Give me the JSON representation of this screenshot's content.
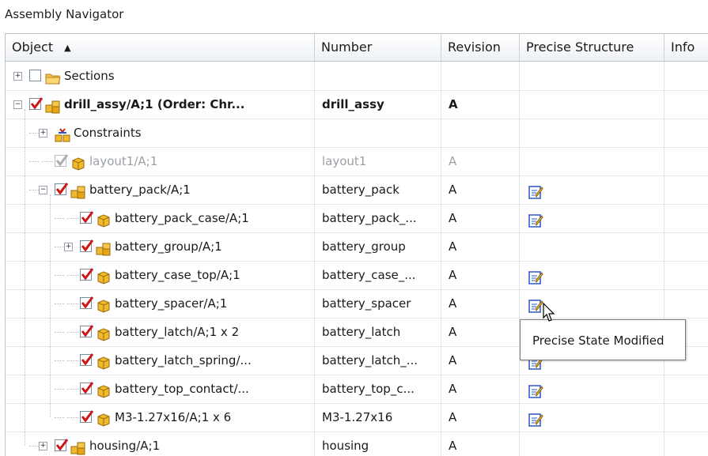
{
  "panel": {
    "title": "Assembly Navigator"
  },
  "columns": {
    "object": "Object",
    "number": "Number",
    "revision": "Revision",
    "precise_structure": "Precise Structure",
    "info": "Info"
  },
  "rows": [
    {
      "object": "Sections",
      "number": "",
      "revision": "",
      "level": 0,
      "expander": "+",
      "checked": "empty",
      "icon": "folder-icon",
      "precise_state_modified": false
    },
    {
      "object": "drill_assy/A;1 (Order: Chr...",
      "number": "drill_assy",
      "revision": "A",
      "level": 0,
      "expander": "-",
      "checked": "checked",
      "icon": "assembly-icon",
      "bold": true,
      "precise_state_modified": false
    },
    {
      "object": "Constraints",
      "number": "",
      "revision": "",
      "level": 1,
      "expander": "+",
      "checked": "none",
      "icon": "constraints-icon",
      "precise_state_modified": false
    },
    {
      "object": "layout1/A;1",
      "number": "layout1",
      "revision": "A",
      "level": 1,
      "expander": "",
      "checked": "greyed",
      "icon": "part-icon",
      "grey": true,
      "precise_state_modified": false
    },
    {
      "object": "battery_pack/A;1",
      "number": "battery_pack",
      "revision": "A",
      "level": 1,
      "expander": "-",
      "checked": "checked",
      "icon": "assembly-icon",
      "precise_state_modified": true
    },
    {
      "object": "battery_pack_case/A;1",
      "number": "battery_pack_...",
      "revision": "A",
      "level": 2,
      "expander": "",
      "checked": "checked",
      "icon": "part-icon",
      "precise_state_modified": true
    },
    {
      "object": "battery_group/A;1",
      "number": "battery_group",
      "revision": "A",
      "level": 2,
      "expander": "+",
      "checked": "checked",
      "icon": "assembly-icon",
      "precise_state_modified": false
    },
    {
      "object": "battery_case_top/A;1",
      "number": "battery_case_...",
      "revision": "A",
      "level": 2,
      "expander": "",
      "checked": "checked",
      "icon": "part-icon",
      "precise_state_modified": true
    },
    {
      "object": "battery_spacer/A;1",
      "number": "battery_spacer",
      "revision": "A",
      "level": 2,
      "expander": "",
      "checked": "checked",
      "icon": "part-icon",
      "precise_state_modified": true
    },
    {
      "object": "battery_latch/A;1 x 2",
      "number": "battery_latch",
      "revision": "A",
      "level": 2,
      "expander": "",
      "checked": "checked",
      "icon": "part-icon",
      "precise_state_modified": false
    },
    {
      "object": "battery_latch_spring/...",
      "number": "battery_latch_...",
      "revision": "A",
      "level": 2,
      "expander": "",
      "checked": "checked",
      "icon": "part-icon",
      "precise_state_modified": true
    },
    {
      "object": "battery_top_contact/...",
      "number": "battery_top_c...",
      "revision": "A",
      "level": 2,
      "expander": "",
      "checked": "checked",
      "icon": "part-icon",
      "precise_state_modified": true
    },
    {
      "object": "M3-1.27x16/A;1 x 6",
      "number": "M3-1.27x16",
      "revision": "A",
      "level": 2,
      "expander": "",
      "checked": "checked",
      "icon": "part-icon",
      "precise_state_modified": true
    },
    {
      "object": "housing/A;1",
      "number": "housing",
      "revision": "A",
      "level": 1,
      "expander": "+",
      "checked": "checked",
      "icon": "assembly-icon",
      "precise_state_modified": false
    }
  ],
  "tooltip": {
    "text": "Precise State Modified"
  },
  "colors": {
    "check_red": "#d01515",
    "folder": "#f2b43a",
    "part_yellow": "#f0b92e",
    "edit_blue": "#2a56c6"
  }
}
